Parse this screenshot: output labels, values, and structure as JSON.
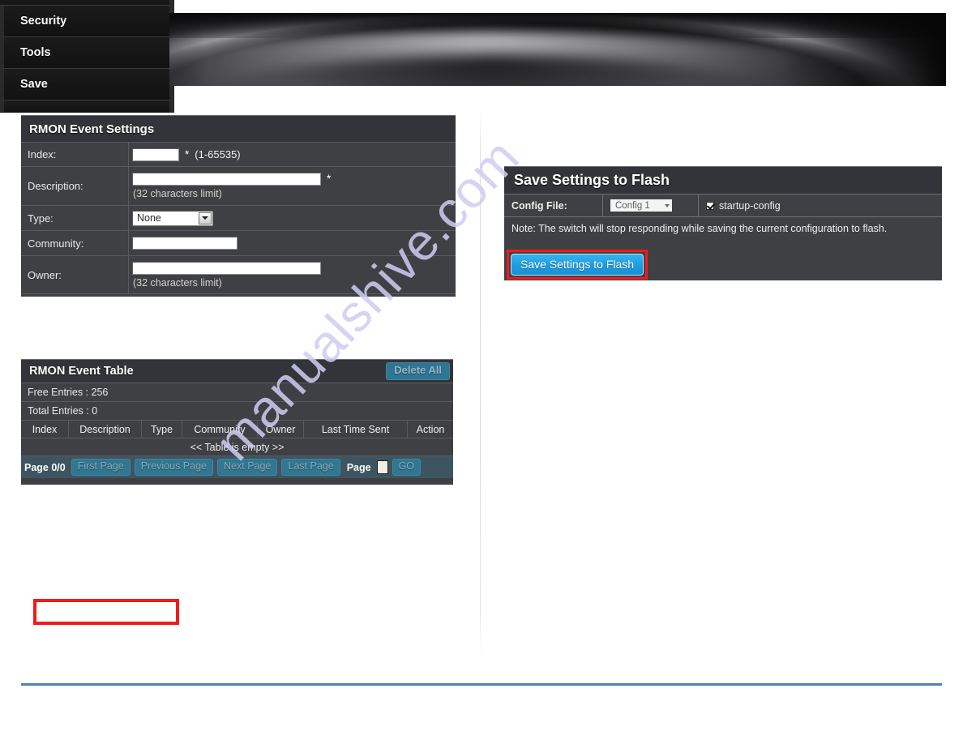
{
  "banner": {
    "alt": "dark-abstract-swoosh-banner"
  },
  "watermark": {
    "text": "manualshive.com"
  },
  "settings": {
    "title": "RMON Event Settings",
    "rows": [
      {
        "label": "Index:",
        "value": "",
        "required_mark": "*",
        "range_hint": "(1-65535)"
      },
      {
        "label": "Description:",
        "value": "",
        "required_mark": "*",
        "hint": "(32 characters limit)"
      },
      {
        "label": "Type:",
        "value": "None"
      },
      {
        "label": "Community:",
        "value": ""
      },
      {
        "label": "Owner:",
        "value": "",
        "hint": "(32 characters limit)"
      }
    ]
  },
  "table": {
    "title": "RMON Event Table",
    "delete_all_label": "Delete All",
    "free_entries": "Free Entries : 256",
    "total_entries": "Total Entries : 0",
    "columns": [
      "Index",
      "Description",
      "Type",
      "Community",
      "Owner",
      "Last Time Sent",
      "Action"
    ],
    "empty_message": "<< Table is empty >>",
    "pager": {
      "page_indicator": "Page 0/0",
      "first": "First Page",
      "previous": "Previous Page",
      "next": "Next Page",
      "last": "Last Page",
      "page_label": "Page",
      "page_value": "",
      "go": "GO"
    }
  },
  "nav": {
    "items": [
      {
        "label": "Security",
        "highlighted": false
      },
      {
        "label": "Tools",
        "highlighted": false
      },
      {
        "label": "Save",
        "highlighted": true
      }
    ]
  },
  "flash": {
    "title": "Save Settings to Flash",
    "config_file_label": "Config File:",
    "config_file_value": "Config 1",
    "startup_config_label": "startup-config",
    "startup_config_checked": true,
    "note": "Note: The switch will stop responding while saving the current configuration to flash.",
    "button_label": "Save Settings to Flash"
  },
  "colors": {
    "panel_bg": "#3f4044",
    "panel_head_bg": "#333439",
    "teal_button": "#2c7698",
    "pager_bg": "#3c5560",
    "blue_button": "#1f9ce0",
    "highlight_red": "#ee1c1c",
    "rule_blue": "#4f81bd",
    "watermark_purple": "#cfcdf2"
  }
}
